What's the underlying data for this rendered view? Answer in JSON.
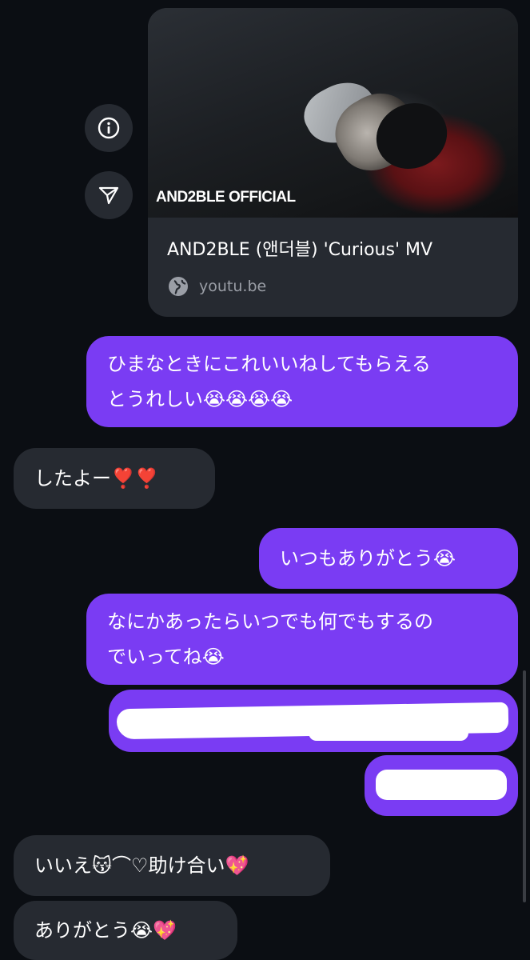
{
  "link_card": {
    "thumbnail_logo": "AND2BLE OFFICIAL",
    "title": "AND2BLE (앤더블) 'Curious' MV",
    "domain": "youtu.be",
    "icons": {
      "info": "info-icon",
      "share": "send-icon",
      "domain": "globe-icon"
    }
  },
  "messages": [
    {
      "direction": "sent",
      "lines": [
        "ひまなときにこれいいねしてもらえる",
        "とうれしい😭😭😭😭"
      ]
    },
    {
      "direction": "received",
      "lines": [
        "したよー❣️❣️"
      ]
    },
    {
      "direction": "sent",
      "lines": [
        "いつもありがとう😭"
      ]
    },
    {
      "direction": "sent",
      "lines": [
        "なにかあったらいつでも何でもするの",
        "でいってね😭"
      ]
    },
    {
      "direction": "sent",
      "redacted": true,
      "lines": []
    },
    {
      "direction": "sent",
      "redacted": true,
      "lines": []
    },
    {
      "direction": "received",
      "lines": [
        "いいえ😽⌒♡助け合い💖"
      ]
    },
    {
      "direction": "received",
      "lines": [
        "ありがとう😭💖"
      ]
    }
  ],
  "colors": {
    "background": "#0b0e13",
    "sent_bubble": "#7a3cf3",
    "received_bubble": "#262a31",
    "secondary_text": "#9a9ea6"
  }
}
